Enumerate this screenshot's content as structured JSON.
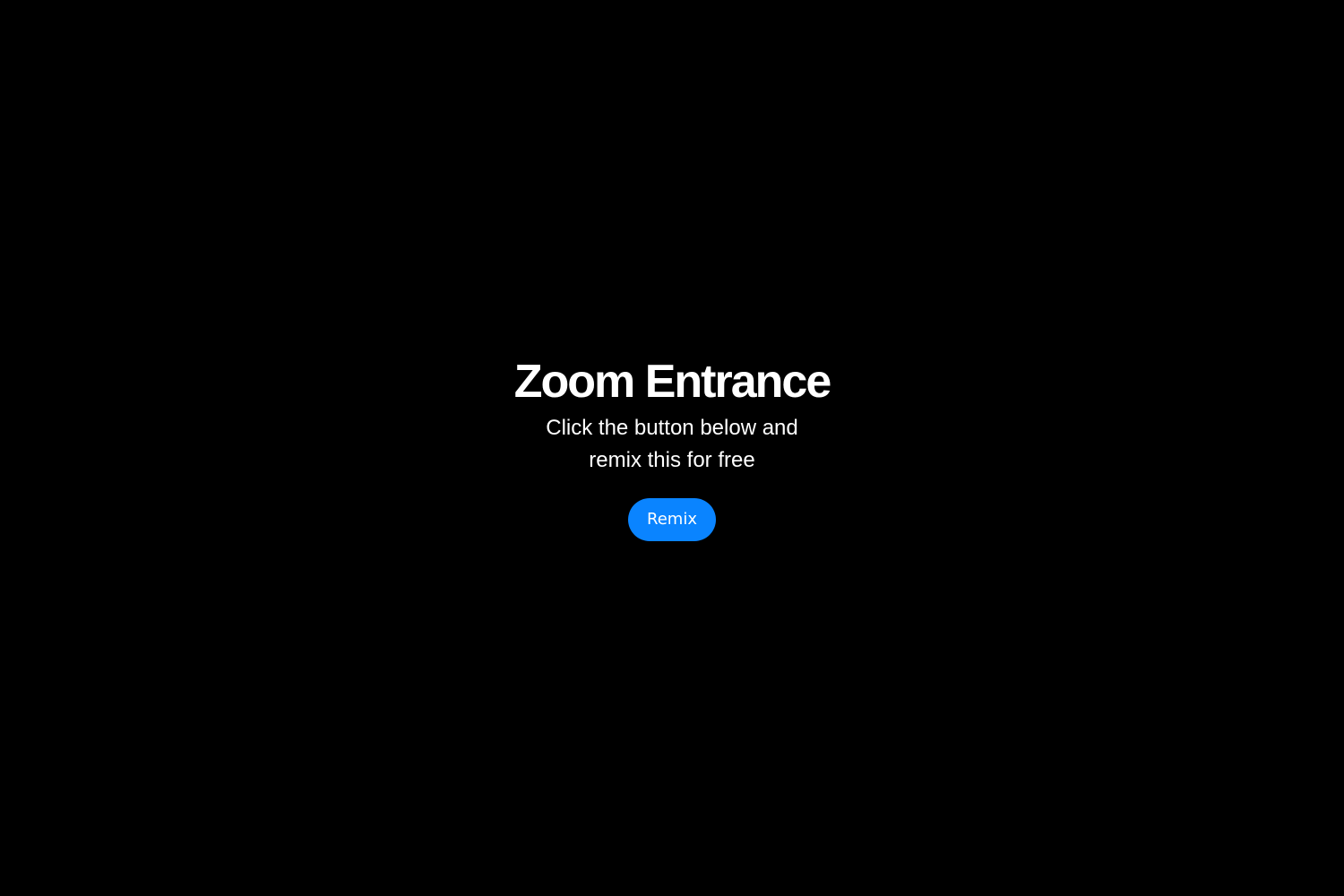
{
  "hero": {
    "title": "Zoom Entrance",
    "subtitle": "Click the button below and remix this for free",
    "button_label": "Remix"
  },
  "colors": {
    "background": "#000000",
    "text": "#ffffff",
    "button": "#0a84ff"
  }
}
